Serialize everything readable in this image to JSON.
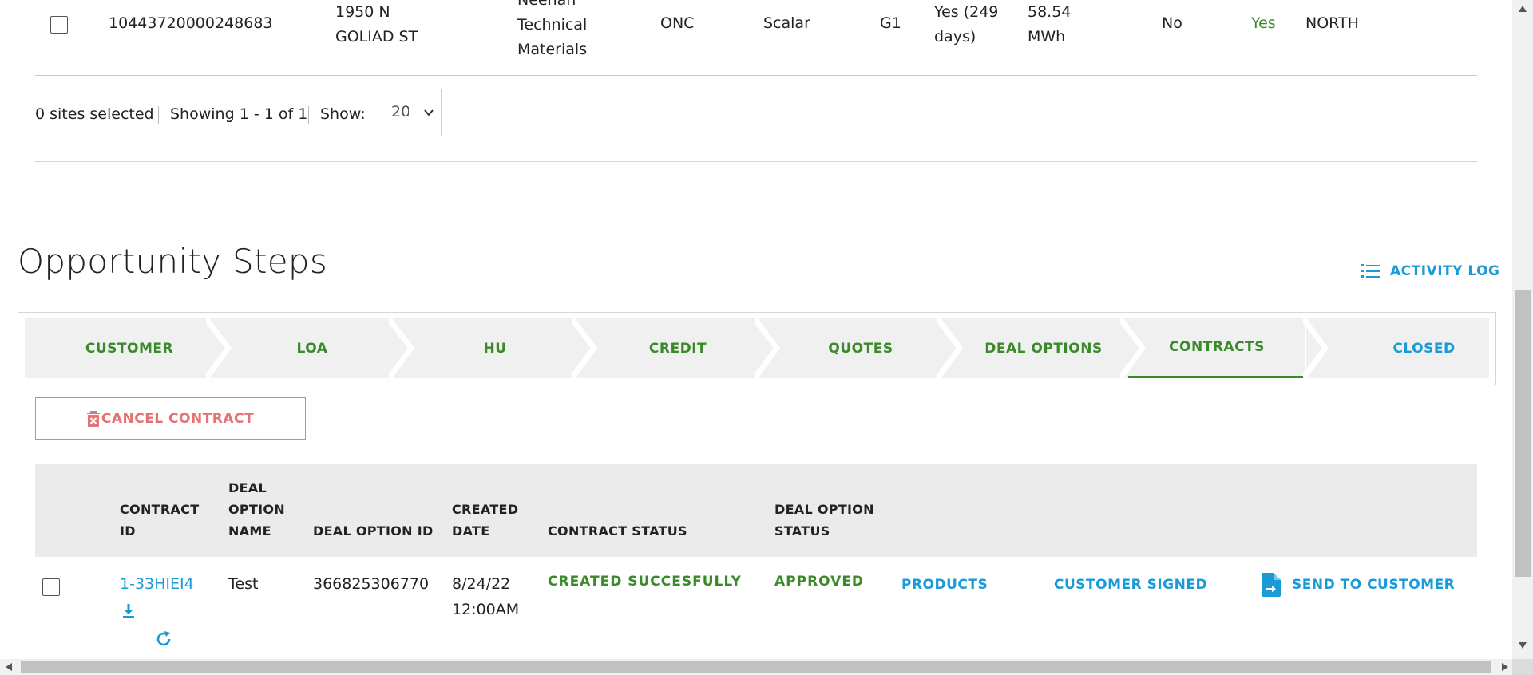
{
  "sites_table": {
    "row": {
      "account_number": "10443720000248683",
      "address_line1": "1950 N",
      "address_line2": "GOLIAD ST",
      "customer_line1": "Neenah",
      "customer_line2": "Technical",
      "customer_line3": "Materials",
      "utility": "ONC",
      "meter_type": "Scalar",
      "rate": "G1",
      "history_line1": "Yes (249",
      "history_line2": "days)",
      "usage_line1": "58.54",
      "usage_line2": "MWh",
      "flag1": "No",
      "flag2": "Yes",
      "zone": "NORTH"
    },
    "footer": {
      "selected": "0 sites selected",
      "showing": "Showing 1 - 1 of 1",
      "show_label": "Show:",
      "page_size": "20"
    }
  },
  "opportunity": {
    "title": "Opportunity Steps",
    "activity_log": "ACTIVITY LOG",
    "steps": [
      {
        "label": "CUSTOMER"
      },
      {
        "label": "LOA"
      },
      {
        "label": "HU"
      },
      {
        "label": "CREDIT"
      },
      {
        "label": "QUOTES"
      },
      {
        "label": "DEAL OPTIONS"
      },
      {
        "label": "CONTRACTS"
      },
      {
        "label": "CLOSED"
      }
    ],
    "active_step": "CONTRACTS",
    "cancel_contract": "CANCEL CONTRACT"
  },
  "contracts_table": {
    "headers": {
      "contract_id_1": "CONTRACT",
      "contract_id_2": "ID",
      "deal_option_name_1": "DEAL",
      "deal_option_name_2": "OPTION",
      "deal_option_name_3": "NAME",
      "deal_option_id": "DEAL OPTION ID",
      "created_date_1": "CREATED",
      "created_date_2": "DATE",
      "contract_status": "CONTRACT STATUS",
      "deal_option_status_1": "DEAL OPTION",
      "deal_option_status_2": "STATUS"
    },
    "row": {
      "contract_id": "1-33HIEI4",
      "deal_option_name": "Test",
      "deal_option_id": "366825306770",
      "created_date": "8/24/22",
      "created_time": "12:00AM",
      "contract_status": "CREATED SUCCESFULLY",
      "deal_option_status": "APPROVED",
      "products": "PRODUCTS",
      "customer_signed": "CUSTOMER SIGNED",
      "send_to_customer": "SEND TO CUSTOMER"
    }
  },
  "colors": {
    "green": "#3a8a2a",
    "blue": "#1a9ad6",
    "red": "#e57373",
    "step_bg": "#f0f0f0"
  }
}
